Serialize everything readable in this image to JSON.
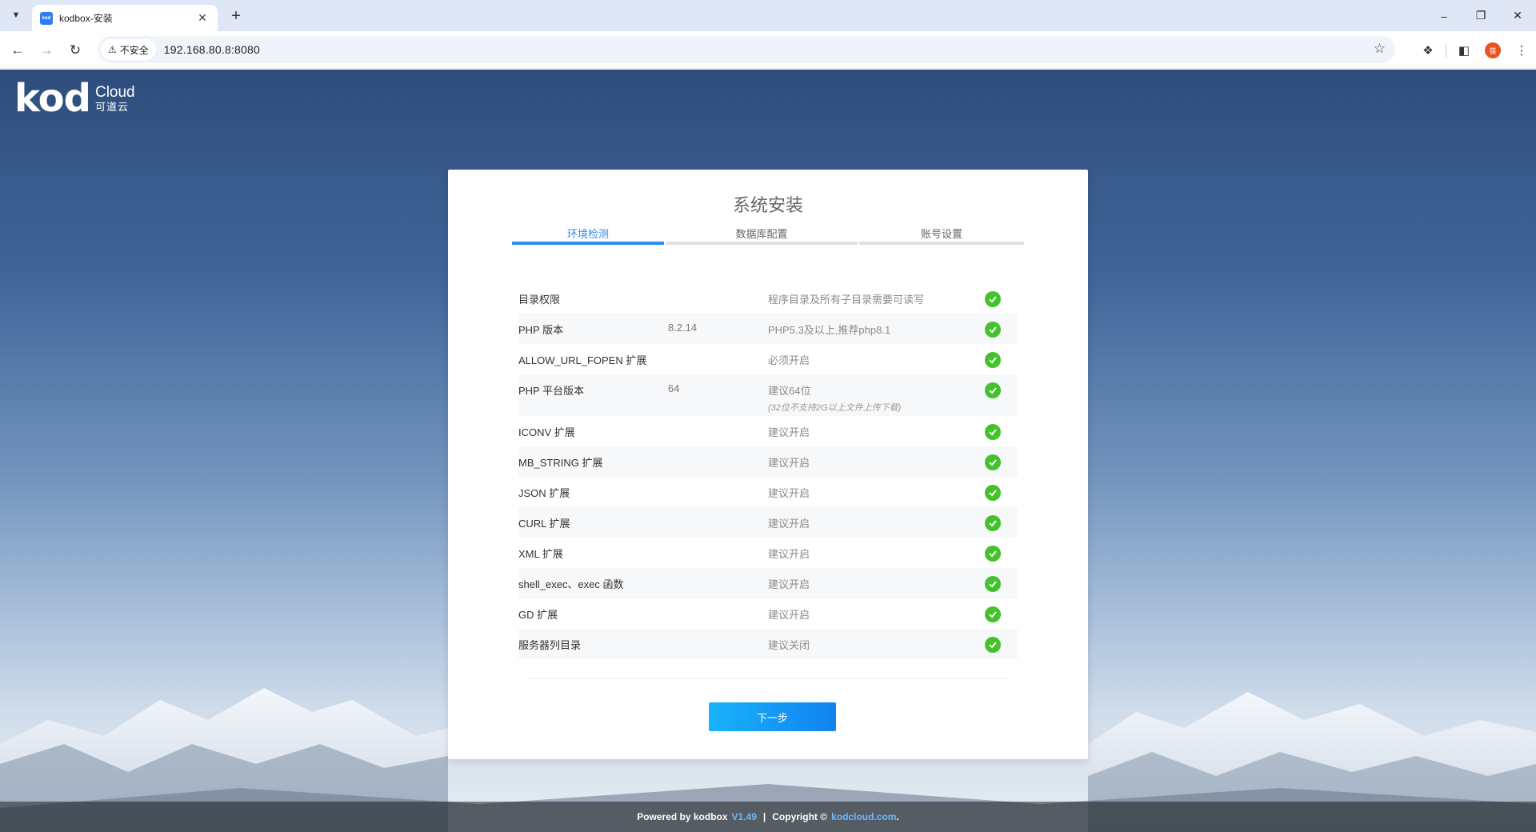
{
  "browser": {
    "tab_title": "kodbox-安装",
    "favicon_text": "kod",
    "new_tab": "+",
    "security_label": "不安全",
    "url": "192.168.80.8:8080",
    "profile_initial": "葆"
  },
  "logo": {
    "main": "kod",
    "cloud": "Cloud",
    "cn": "可道云"
  },
  "installer": {
    "title": "系统安装",
    "steps": [
      {
        "label": "环境检测",
        "active": true
      },
      {
        "label": "数据库配置",
        "active": false
      },
      {
        "label": "账号设置",
        "active": false
      }
    ],
    "checks": [
      {
        "name": "目录权限",
        "value": "",
        "desc": "程序目录及所有子目录需要可读写",
        "sub": "",
        "status": "ok"
      },
      {
        "name": "PHP 版本",
        "value": "8.2.14",
        "desc": "PHP5.3及以上,推荐php8.1",
        "sub": "",
        "status": "ok"
      },
      {
        "name": "ALLOW_URL_FOPEN 扩展",
        "value": "",
        "desc": "必须开启",
        "sub": "",
        "status": "ok"
      },
      {
        "name": "PHP 平台版本",
        "value": "64",
        "desc": "建议64位",
        "sub": "(32位不支持2G以上文件上传下载)",
        "status": "ok"
      },
      {
        "name": "ICONV 扩展",
        "value": "",
        "desc": "建议开启",
        "sub": "",
        "status": "ok"
      },
      {
        "name": "MB_STRING 扩展",
        "value": "",
        "desc": "建议开启",
        "sub": "",
        "status": "ok"
      },
      {
        "name": "JSON 扩展",
        "value": "",
        "desc": "建议开启",
        "sub": "",
        "status": "ok"
      },
      {
        "name": "CURL 扩展",
        "value": "",
        "desc": "建议开启",
        "sub": "",
        "status": "ok"
      },
      {
        "name": "XML 扩展",
        "value": "",
        "desc": "建议开启",
        "sub": "",
        "status": "ok"
      },
      {
        "name": "shell_exec、exec 函数",
        "value": "",
        "desc": "建议开启",
        "sub": "",
        "status": "ok"
      },
      {
        "name": "GD 扩展",
        "value": "",
        "desc": "建议开启",
        "sub": "",
        "status": "ok"
      },
      {
        "name": "服务器列目录",
        "value": "",
        "desc": "建议关闭",
        "sub": "",
        "status": "ok"
      }
    ],
    "next_label": "下一步"
  },
  "footer": {
    "powered": "Powered by kodbox",
    "version": "V1.49",
    "separator": "|",
    "copyright": "Copyright ©",
    "site": "kodcloud.com",
    "end": "."
  },
  "colors": {
    "accent": "#2d8cf0",
    "ok": "#43c22b",
    "button_start": "#18b3fa",
    "button_end": "#1182f0"
  }
}
